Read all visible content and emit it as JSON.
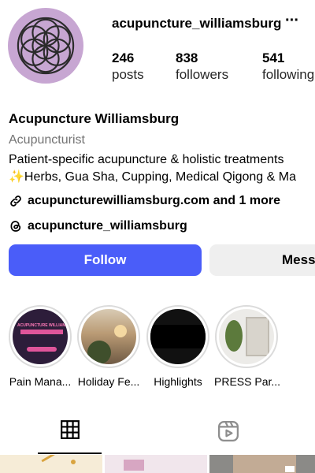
{
  "profile": {
    "username": "acupuncture_williamsburg",
    "more_label": "···",
    "stats": {
      "posts": {
        "value": "246",
        "label": "posts"
      },
      "followers": {
        "value": "838",
        "label": "followers"
      },
      "following": {
        "value": "541",
        "label": "following"
      }
    },
    "name": "Acupuncture Williamsburg",
    "category": "Acupuncturist",
    "bio_line1": "Patient-specific acupuncture & holistic treatments",
    "bio_line2_emoji": "✨",
    "bio_line2": "Herbs, Gua Sha, Cupping, Medical Qigong & Ma",
    "link_text": "acupuncturewilliamsburg.com and 1 more",
    "threads_handle": "acupuncture_williamsburg"
  },
  "actions": {
    "follow_label": "Follow",
    "message_label": "Message"
  },
  "highlights": [
    {
      "label": "Pain Mana...",
      "thumb_text": "ACUPUNCTURE WILLIAMSBURG"
    },
    {
      "label": "Holiday Fe..."
    },
    {
      "label": "Highlights"
    },
    {
      "label": "PRESS Par..."
    }
  ],
  "tabs": [
    {
      "name": "posts-grid",
      "icon": "grid-icon",
      "selected": true
    },
    {
      "name": "reels",
      "icon": "reels-icon",
      "selected": false
    }
  ],
  "colors": {
    "accent": "#4a5df9",
    "avatar_bg": "#c7a6d2",
    "secondary_text": "#737373",
    "button_gray": "#efefef"
  }
}
